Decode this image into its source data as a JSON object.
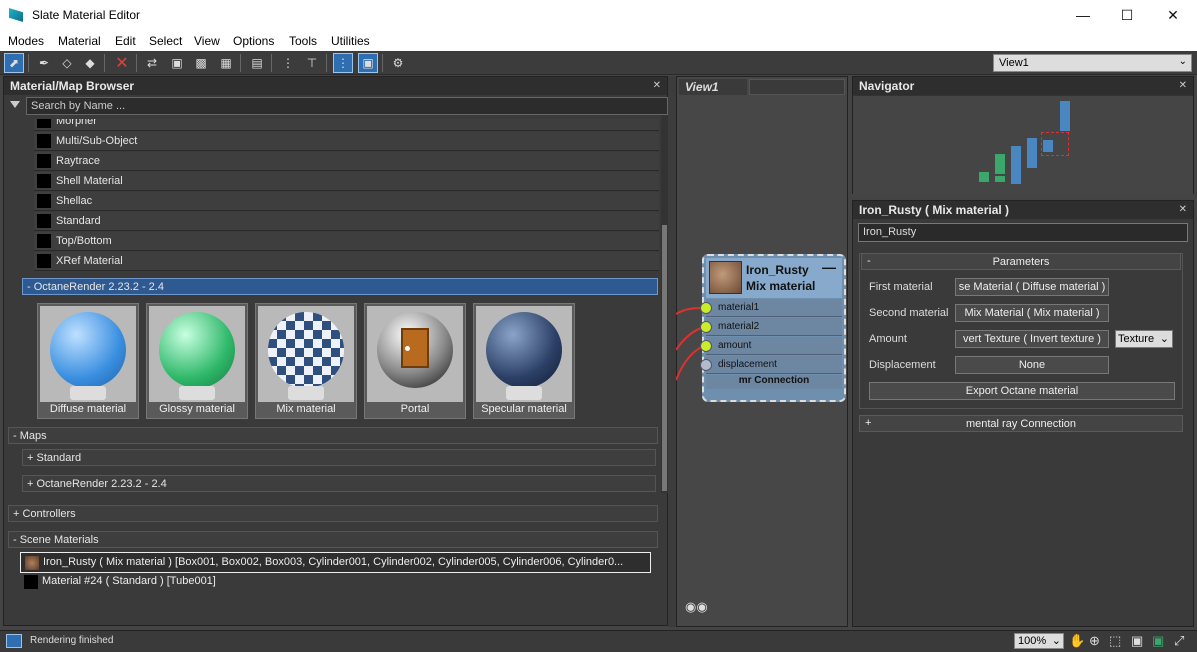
{
  "window": {
    "title": "Slate Material Editor"
  },
  "menu": [
    "Modes",
    "Material",
    "Edit",
    "Select",
    "View",
    "Options",
    "Tools",
    "Utilities"
  ],
  "toolbar": {
    "view_select": "View1"
  },
  "browser": {
    "title": "Material/Map Browser",
    "search_placeholder": "Search by Name ...",
    "list_items": [
      "Morpher",
      "Multi/Sub-Object",
      "Raytrace",
      "Shell Material",
      "Shellac",
      "Standard",
      "Top/Bottom",
      "XRef Material"
    ],
    "octane_group": "- OctaneRender 2.23.2 - 2.4",
    "thumbs": [
      "Diffuse material",
      "Glossy material",
      "Mix material",
      "Portal",
      "Specular material"
    ],
    "maps": "- Maps",
    "maps_standard": "+ Standard",
    "maps_octane": "+ OctaneRender 2.23.2 - 2.4",
    "controllers": "+ Controllers",
    "scene_materials": "- Scene Materials",
    "scene_rows": [
      "Iron_Rusty  ( Mix material )  [Box001, Box002, Box003, Cylinder001, Cylinder002, Cylinder005, Cylinder006, Cylinder0...",
      "Material #24  ( Standard )  [Tube001]"
    ]
  },
  "view1": {
    "tab": "View1",
    "node": {
      "name": "Iron_Rusty",
      "type": "Mix material",
      "ports": [
        "material1",
        "material2",
        "amount",
        "displacement"
      ],
      "footer": "mr Connection"
    }
  },
  "navigator": {
    "title": "Navigator"
  },
  "props": {
    "title": "Iron_Rusty  ( Mix material )",
    "name_value": "Iron_Rusty",
    "params_header": "Parameters",
    "params_collapse": "-",
    "first_label": "First material",
    "first_value": "se Material  ( Diffuse material )",
    "second_label": "Second material",
    "second_value": "Mix Material  ( Mix material )",
    "amount_label": "Amount",
    "amount_value": "vert Texture  ( Invert texture )",
    "amount_type": "Texture",
    "displacement_label": "Displacement",
    "displacement_value": "None",
    "export_label": "Export Octane material",
    "mr_expand": "+",
    "mr_label": "mental ray Connection"
  },
  "status": {
    "text": "Rendering finished",
    "zoom": "100%"
  }
}
